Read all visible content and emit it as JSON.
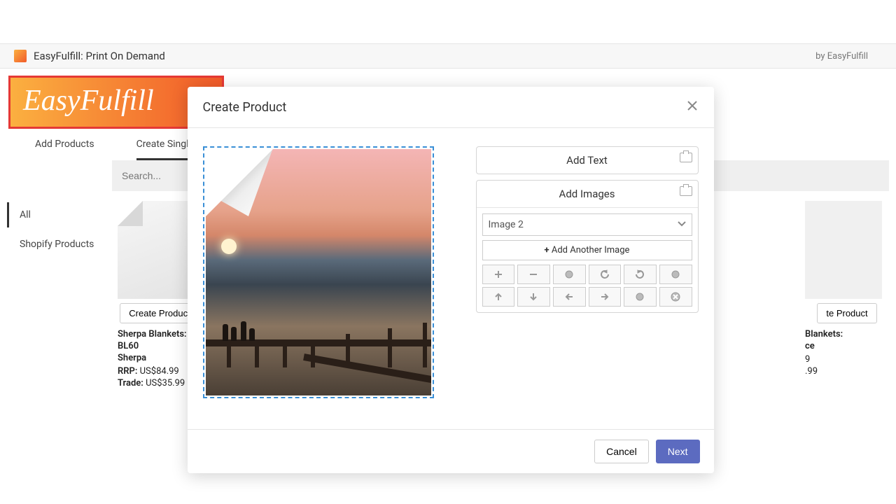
{
  "topbar": {
    "title": "EasyFulfill: Print On Demand",
    "by": "by EasyFulfill"
  },
  "logo_text": "EasyFulfill",
  "tabs": [
    "Add Products",
    "Create Single Product"
  ],
  "sidebar": {
    "items": [
      "All",
      "Shopify Products"
    ]
  },
  "search": {
    "placeholder": "Search..."
  },
  "products": {
    "left": {
      "create_label": "Create Product",
      "name_line1": "Sherpa Blankets: BL60",
      "name_line2": "Sherpa",
      "rrp_label": "RRP:",
      "rrp_val": " US$84.99",
      "trade_label": "Trade:",
      "trade_val": " US$35.99"
    },
    "right": {
      "create_label": "te Product",
      "name_line1": "Blankets:",
      "name_line2": "ce",
      "rrp_val": "9",
      "trade_val": ".99"
    }
  },
  "modal": {
    "title": "Create Product",
    "add_text_label": "Add Text",
    "add_images_label": "Add Images",
    "select_value": "Image 2",
    "add_another_label": "Add Another Image",
    "cancel": "Cancel",
    "next": "Next"
  }
}
